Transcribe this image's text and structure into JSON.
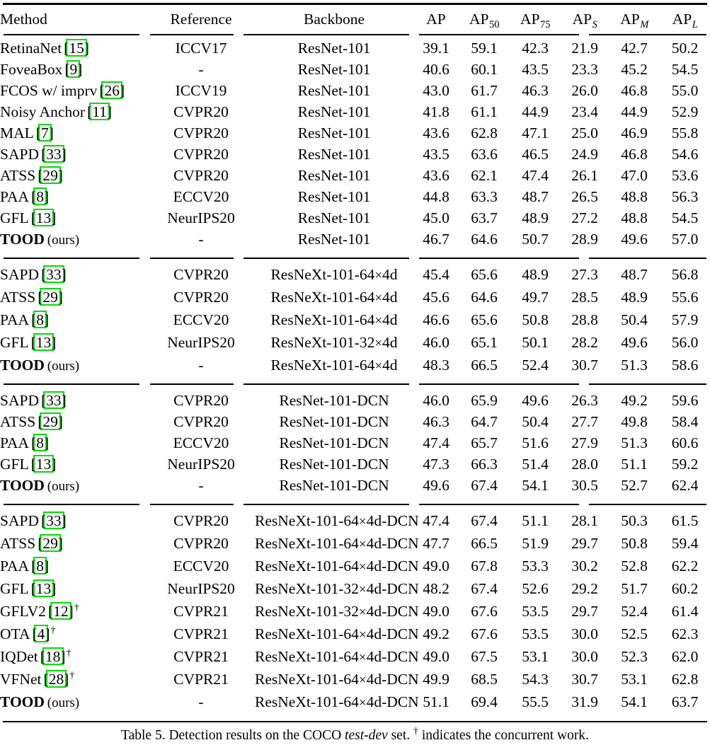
{
  "table": {
    "columns": [
      {
        "key": "method",
        "label": "Method"
      },
      {
        "key": "reference",
        "label": "Reference"
      },
      {
        "key": "backbone",
        "label": "Backbone"
      },
      {
        "key": "ap",
        "label": "AP",
        "sub": ""
      },
      {
        "key": "ap50",
        "label": "AP",
        "sub": "50"
      },
      {
        "key": "ap75",
        "label": "AP",
        "sub": "75"
      },
      {
        "key": "aps",
        "label": "AP",
        "sub": "S"
      },
      {
        "key": "apm",
        "label": "AP",
        "sub": "M"
      },
      {
        "key": "apl",
        "label": "AP",
        "sub": "L"
      }
    ],
    "blocks": [
      {
        "rows": [
          {
            "method": "RetinaNet",
            "cite": "15",
            "dagger": false,
            "reference": "ICCV17",
            "backbone": "ResNet-101",
            "ap": "39.1",
            "ap50": "59.1",
            "ap75": "42.3",
            "aps": "21.9",
            "apm": "42.7",
            "apl": "50.2",
            "bold": false
          },
          {
            "method": "FoveaBox",
            "cite": "9",
            "dagger": false,
            "reference": "-",
            "backbone": "ResNet-101",
            "ap": "40.6",
            "ap50": "60.1",
            "ap75": "43.5",
            "aps": "23.3",
            "apm": "45.2",
            "apl": "54.5",
            "bold": false
          },
          {
            "method": "FCOS w/ imprv",
            "cite": "26",
            "dagger": false,
            "reference": "ICCV19",
            "backbone": "ResNet-101",
            "ap": "43.0",
            "ap50": "61.7",
            "ap75": "46.3",
            "aps": "26.0",
            "apm": "46.8",
            "apl": "55.0",
            "bold": false
          },
          {
            "method": "Noisy Anchor",
            "cite": "11",
            "dagger": false,
            "reference": "CVPR20",
            "backbone": "ResNet-101",
            "ap": "41.8",
            "ap50": "61.1",
            "ap75": "44.9",
            "aps": "23.4",
            "apm": "44.9",
            "apl": "52.9",
            "bold": false
          },
          {
            "method": "MAL",
            "cite": "7",
            "dagger": false,
            "reference": "CVPR20",
            "backbone": "ResNet-101",
            "ap": "43.6",
            "ap50": "62.8",
            "ap75": "47.1",
            "aps": "25.0",
            "apm": "46.9",
            "apl": "55.8",
            "bold": false
          },
          {
            "method": "SAPD",
            "cite": "33",
            "dagger": false,
            "reference": "CVPR20",
            "backbone": "ResNet-101",
            "ap": "43.5",
            "ap50": "63.6",
            "ap75": "46.5",
            "aps": "24.9",
            "apm": "46.8",
            "apl": "54.6",
            "bold": false
          },
          {
            "method": "ATSS",
            "cite": "29",
            "dagger": false,
            "reference": "CVPR20",
            "backbone": "ResNet-101",
            "ap": "43.6",
            "ap50": "62.1",
            "ap75": "47.4",
            "aps": "26.1",
            "apm": "47.0",
            "apl": "53.6",
            "bold": false
          },
          {
            "method": "PAA",
            "cite": "8",
            "dagger": false,
            "reference": "ECCV20",
            "backbone": "ResNet-101",
            "ap": "44.8",
            "ap50": "63.3",
            "ap75": "48.7",
            "aps": "26.5",
            "apm": "48.8",
            "apl": "56.3",
            "bold": false
          },
          {
            "method": "GFL",
            "cite": "13",
            "dagger": false,
            "reference": "NeurIPS20",
            "backbone": "ResNet-101",
            "ap": "45.0",
            "ap50": "63.7",
            "ap75": "48.9",
            "aps": "27.2",
            "apm": "48.8",
            "apl": "54.5",
            "bold": false
          },
          {
            "method": "TOOD",
            "suffix": "(ours)",
            "cite": null,
            "dagger": false,
            "reference": "-",
            "backbone": "ResNet-101",
            "ap": "46.7",
            "ap50": "64.6",
            "ap75": "50.7",
            "aps": "28.9",
            "apm": "49.6",
            "apl": "57.0",
            "bold": true
          }
        ]
      },
      {
        "rows": [
          {
            "method": "SAPD",
            "cite": "33",
            "dagger": false,
            "reference": "CVPR20",
            "backbone": "ResNeXt-101-64×4d",
            "ap": "45.4",
            "ap50": "65.6",
            "ap75": "48.9",
            "aps": "27.3",
            "apm": "48.7",
            "apl": "56.8",
            "bold": false
          },
          {
            "method": "ATSS",
            "cite": "29",
            "dagger": false,
            "reference": "CVPR20",
            "backbone": "ResNeXt-101-64×4d",
            "ap": "45.6",
            "ap50": "64.6",
            "ap75": "49.7",
            "aps": "28.5",
            "apm": "48.9",
            "apl": "55.6",
            "bold": false
          },
          {
            "method": "PAA",
            "cite": "8",
            "dagger": false,
            "reference": "ECCV20",
            "backbone": "ResNeXt-101-64×4d",
            "ap": "46.6",
            "ap50": "65.6",
            "ap75": "50.8",
            "aps": "28.8",
            "apm": "50.4",
            "apl": "57.9",
            "bold": false
          },
          {
            "method": "GFL",
            "cite": "13",
            "dagger": false,
            "reference": "NeurIPS20",
            "backbone": "ResNeXt-101-32×4d",
            "ap": "46.0",
            "ap50": "65.1",
            "ap75": "50.1",
            "aps": "28.2",
            "apm": "49.6",
            "apl": "56.0",
            "bold": false
          },
          {
            "method": "TOOD",
            "suffix": "(ours)",
            "cite": null,
            "dagger": false,
            "reference": "-",
            "backbone": "ResNeXt-101-64×4d",
            "ap": "48.3",
            "ap50": "66.5",
            "ap75": "52.4",
            "aps": "30.7",
            "apm": "51.3",
            "apl": "58.6",
            "bold": true
          }
        ]
      },
      {
        "rows": [
          {
            "method": "SAPD",
            "cite": "33",
            "dagger": false,
            "reference": "CVPR20",
            "backbone": "ResNet-101-DCN",
            "ap": "46.0",
            "ap50": "65.9",
            "ap75": "49.6",
            "aps": "26.3",
            "apm": "49.2",
            "apl": "59.6",
            "bold": false
          },
          {
            "method": "ATSS",
            "cite": "29",
            "dagger": false,
            "reference": "CVPR20",
            "backbone": "ResNet-101-DCN",
            "ap": "46.3",
            "ap50": "64.7",
            "ap75": "50.4",
            "aps": "27.7",
            "apm": "49.8",
            "apl": "58.4",
            "bold": false
          },
          {
            "method": "PAA",
            "cite": "8",
            "dagger": false,
            "reference": "ECCV20",
            "backbone": "ResNet-101-DCN",
            "ap": "47.4",
            "ap50": "65.7",
            "ap75": "51.6",
            "aps": "27.9",
            "apm": "51.3",
            "apl": "60.6",
            "bold": false
          },
          {
            "method": "GFL",
            "cite": "13",
            "dagger": false,
            "reference": "NeurIPS20",
            "backbone": "ResNet-101-DCN",
            "ap": "47.3",
            "ap50": "66.3",
            "ap75": "51.4",
            "aps": "28.0",
            "apm": "51.1",
            "apl": "59.2",
            "bold": false
          },
          {
            "method": "TOOD",
            "suffix": "(ours)",
            "cite": null,
            "dagger": false,
            "reference": "-",
            "backbone": "ResNet-101-DCN",
            "ap": "49.6",
            "ap50": "67.4",
            "ap75": "54.1",
            "aps": "30.5",
            "apm": "52.7",
            "apl": "62.4",
            "bold": true
          }
        ]
      },
      {
        "rows": [
          {
            "method": "SAPD",
            "cite": "33",
            "dagger": false,
            "reference": "CVPR20",
            "backbone": "ResNeXt-101-64×4d-DCN",
            "ap": "47.4",
            "ap50": "67.4",
            "ap75": "51.1",
            "aps": "28.1",
            "apm": "50.3",
            "apl": "61.5",
            "bold": false
          },
          {
            "method": "ATSS",
            "cite": "29",
            "dagger": false,
            "reference": "CVPR20",
            "backbone": "ResNeXt-101-64×4d-DCN",
            "ap": "47.7",
            "ap50": "66.5",
            "ap75": "51.9",
            "aps": "29.7",
            "apm": "50.8",
            "apl": "59.4",
            "bold": false
          },
          {
            "method": "PAA",
            "cite": "8",
            "dagger": false,
            "reference": "ECCV20",
            "backbone": "ResNeXt-101-64×4d-DCN",
            "ap": "49.0",
            "ap50": "67.8",
            "ap75": "53.3",
            "aps": "30.2",
            "apm": "52.8",
            "apl": "62.2",
            "bold": false
          },
          {
            "method": "GFL",
            "cite": "13",
            "dagger": false,
            "reference": "NeurIPS20",
            "backbone": "ResNeXt-101-32×4d-DCN",
            "ap": "48.2",
            "ap50": "67.4",
            "ap75": "52.6",
            "aps": "29.2",
            "apm": "51.7",
            "apl": "60.2",
            "bold": false
          },
          {
            "method": "GFLV2",
            "cite": "12",
            "dagger": true,
            "reference": "CVPR21",
            "backbone": "ResNeXt-101-32×4d-DCN",
            "ap": "49.0",
            "ap50": "67.6",
            "ap75": "53.5",
            "aps": "29.7",
            "apm": "52.4",
            "apl": "61.4",
            "bold": false
          },
          {
            "method": "OTA",
            "cite": "4",
            "dagger": true,
            "reference": "CVPR21",
            "backbone": "ResNeXt-101-64×4d-DCN",
            "ap": "49.2",
            "ap50": "67.6",
            "ap75": "53.5",
            "aps": "30.0",
            "apm": "52.5",
            "apl": "62.3",
            "bold": false
          },
          {
            "method": "IQDet",
            "cite": "18",
            "dagger": true,
            "reference": "CVPR21",
            "backbone": "ResNeXt-101-64×4d-DCN",
            "ap": "49.0",
            "ap50": "67.5",
            "ap75": "53.1",
            "aps": "30.0",
            "apm": "52.3",
            "apl": "62.0",
            "bold": false
          },
          {
            "method": "VFNet",
            "cite": "28",
            "dagger": true,
            "reference": "CVPR21",
            "backbone": "ResNeXt-101-64×4d-DCN",
            "ap": "49.9",
            "ap50": "68.5",
            "ap75": "54.3",
            "aps": "30.7",
            "apm": "53.1",
            "apl": "62.8",
            "bold": false
          },
          {
            "method": "TOOD",
            "suffix": "(ours)",
            "cite": null,
            "dagger": false,
            "reference": "-",
            "backbone": "ResNeXt-101-64×4d-DCN",
            "ap": "51.1",
            "ap50": "69.4",
            "ap75": "55.5",
            "aps": "31.9",
            "apm": "54.1",
            "apl": "63.7",
            "bold": true
          }
        ]
      }
    ]
  },
  "caption": {
    "prefix": "Table 5. Detection results on the COCO ",
    "italic": "test-dev",
    "middle": " set. ",
    "dagger": "†",
    "suffix": " indicates the concurrent work."
  },
  "colors": {
    "citation_link_box": "#00dd00",
    "rule": "#000000",
    "text": "#000000",
    "background": "#ffffff"
  }
}
